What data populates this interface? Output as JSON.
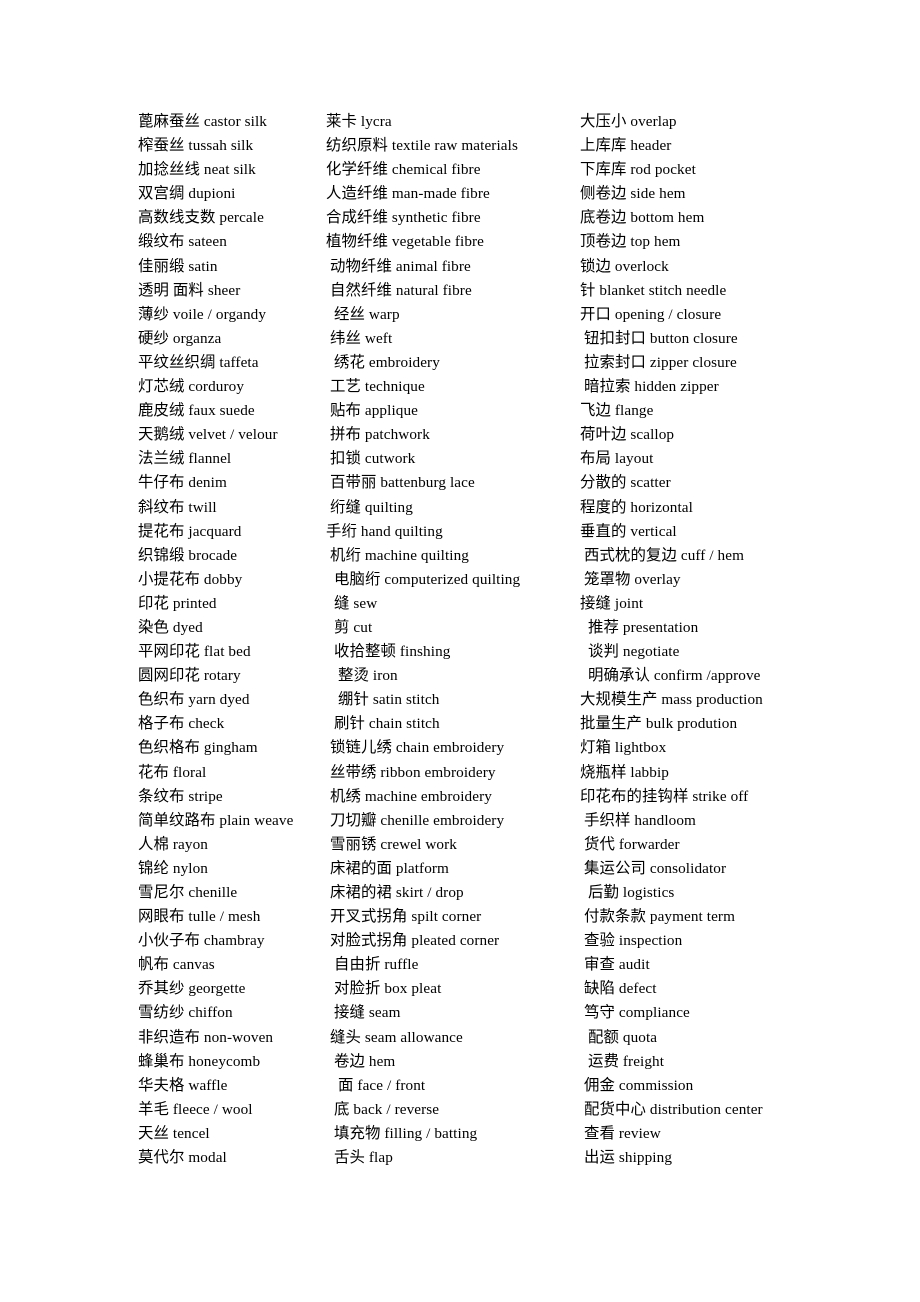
{
  "document": {
    "type": "glossary",
    "title": "Chinese-English Textile / Home Textile Glossary",
    "column_count": 3,
    "rows_per_column": 44
  },
  "columns": [
    {
      "name": "fabrics-and-materials",
      "entries": [
        {
          "zh": "蓖麻蚕丝",
          "en": "castor silk",
          "indent": 0
        },
        {
          "zh": "榨蚕丝",
          "en": "tussah silk",
          "indent": 0
        },
        {
          "zh": "加捻丝线",
          "en": " neat silk",
          "indent": 0
        },
        {
          "zh": "双宫绸",
          "en": "dupioni",
          "indent": 0
        },
        {
          "zh": "高数线支数",
          "en": " percale",
          "indent": 0
        },
        {
          "zh": "缎纹布",
          "en": " sateen",
          "indent": 0
        },
        {
          "zh": "佳丽缎",
          "en": "satin",
          "indent": 0
        },
        {
          "zh": "透明 面料",
          "en": " sheer",
          "indent": 0
        },
        {
          "zh": "薄纱",
          "en": "voile / organdy",
          "indent": 0
        },
        {
          "zh": "硬纱",
          "en": " organza",
          "indent": 0
        },
        {
          "zh": "平纹丝织绸",
          "en": "taffeta",
          "indent": 0
        },
        {
          "zh": "灯芯绒",
          "en": " corduroy",
          "indent": 0
        },
        {
          "zh": "鹿皮绒",
          "en": " faux suede",
          "indent": 0
        },
        {
          "zh": "天鹅绒",
          "en": " velvet / velour",
          "indent": 0
        },
        {
          "zh": "法兰绒",
          "en": " flannel",
          "indent": 0
        },
        {
          "zh": "牛仔布",
          "en": "denim",
          "indent": 0
        },
        {
          "zh": "斜纹布",
          "en": " twill",
          "indent": 0
        },
        {
          "zh": "提花布",
          "en": "jacquard",
          "indent": 0
        },
        {
          "zh": "织锦缎",
          "en": "brocade",
          "indent": 0
        },
        {
          "zh": "小提花布",
          "en": "  dobby",
          "indent": 0
        },
        {
          "zh": "印花",
          "en": "printed",
          "indent": 0
        },
        {
          "zh": "染色",
          "en": "  dyed",
          "indent": 0
        },
        {
          "zh": "平网印花",
          "en": " flat bed",
          "indent": 0
        },
        {
          "zh": "圆网印花",
          "en": "rotary",
          "indent": 0
        },
        {
          "zh": "色织布",
          "en": "yarn dyed",
          "indent": 0
        },
        {
          "zh": "格子布",
          "en": "check",
          "indent": 0
        },
        {
          "zh": "色织格布",
          "en": " gingham",
          "indent": 0
        },
        {
          "zh": "花布",
          "en": "floral",
          "indent": 0
        },
        {
          "zh": "条纹布",
          "en": "stripe",
          "indent": 0
        },
        {
          "zh": "简单纹路布",
          "en": "plain weave",
          "indent": 0
        },
        {
          "zh": "人棉",
          "en": "rayon",
          "indent": 0
        },
        {
          "zh": "锦纶",
          "en": "nylon",
          "indent": 0
        },
        {
          "zh": "雪尼尔",
          "en": " chenille",
          "indent": 0
        },
        {
          "zh": "网眼布",
          "en": " tulle / mesh",
          "indent": 0
        },
        {
          "zh": "小伙子布",
          "en": "chambray",
          "indent": 0
        },
        {
          "zh": "帆布",
          "en": " canvas",
          "indent": 0
        },
        {
          "zh": "乔其纱",
          "en": "georgette",
          "indent": 0
        },
        {
          "zh": "雪纺纱",
          "en": " chiffon",
          "indent": 0
        },
        {
          "zh": "非织造布",
          "en": "non-woven",
          "indent": 0
        },
        {
          "zh": "蜂巢布",
          "en": "honeycomb",
          "indent": 0
        },
        {
          "zh": "华夫格",
          "en": " waffle",
          "indent": 0
        },
        {
          "zh": "羊毛",
          "en": "fleece / wool",
          "indent": 0
        },
        {
          "zh": "天丝",
          "en": " tencel",
          "indent": 0
        },
        {
          "zh": "莫代尔",
          "en": "modal",
          "indent": 0
        }
      ]
    },
    {
      "name": "fibres-and-techniques",
      "entries": [
        {
          "zh": "莱卡",
          "en": " lycra",
          "indent": 0
        },
        {
          "zh": "纺织原料",
          "en": "textile raw materials",
          "indent": 0
        },
        {
          "zh": "化学纤维",
          "en": "chemical fibre",
          "indent": 0
        },
        {
          "zh": "人造纤维",
          "en": "man-made fibre",
          "indent": 0
        },
        {
          "zh": "合成纤维",
          "en": "synthetic fibre",
          "indent": 0
        },
        {
          "zh": "植物纤维",
          "en": " vegetable fibre",
          "indent": 0
        },
        {
          "zh": "动物纤维",
          "en": " animal fibre",
          "indent": 1
        },
        {
          "zh": "自然纤维",
          "en": " natural fibre",
          "indent": 1
        },
        {
          "zh": "经丝",
          "en": "warp",
          "indent": 2
        },
        {
          "zh": "纬丝",
          "en": "weft",
          "indent": 1
        },
        {
          "zh": "绣花",
          "en": "embroidery",
          "indent": 2
        },
        {
          "zh": "工艺",
          "en": "technique",
          "indent": 1
        },
        {
          "zh": "贴布",
          "en": "applique",
          "indent": 1
        },
        {
          "zh": "拼布",
          "en": "patchwork",
          "indent": 1
        },
        {
          "zh": "扣锁",
          "en": "cutwork",
          "indent": 1
        },
        {
          "zh": "百带丽",
          "en": "battenburg lace",
          "indent": 1
        },
        {
          "zh": "绗缝",
          "en": "quilting",
          "indent": 1
        },
        {
          "zh": "手绗",
          "en": "hand quilting",
          "indent": 0
        },
        {
          "zh": "机绗",
          "en": "machine quilting",
          "indent": 1
        },
        {
          "zh": "电脑绗",
          "en": "computerized quilting",
          "indent": 2
        },
        {
          "zh": "缝",
          "en": "sew",
          "indent": 2
        },
        {
          "zh": "剪",
          "en": " cut",
          "indent": 2
        },
        {
          "zh": "收拾整顿",
          "en": "finshing",
          "indent": 2
        },
        {
          "zh": "整烫",
          "en": " iron",
          "indent": 3
        },
        {
          "zh": "绷针",
          "en": "satin stitch",
          "indent": 3
        },
        {
          "zh": "刷针",
          "en": " chain stitch",
          "indent": 2
        },
        {
          "zh": "锁链儿绣",
          "en": "chain embroidery",
          "indent": 1
        },
        {
          "zh": "丝带绣",
          "en": "ribbon embroidery",
          "indent": 1
        },
        {
          "zh": "机绣",
          "en": " machine embroidery",
          "indent": 1
        },
        {
          "zh": "刀切瓣",
          "en": "chenille embroidery",
          "indent": 1
        },
        {
          "zh": "雪丽锈",
          "en": "crewel work",
          "indent": 1
        },
        {
          "zh": "床裙的面",
          "en": "platform",
          "indent": 1
        },
        {
          "zh": "床裙的裙",
          "en": "  skirt / drop",
          "indent": 1
        },
        {
          "zh": "开叉式拐角",
          "en": "spilt corner",
          "indent": 1
        },
        {
          "zh": "对脸式拐角",
          "en": " pleated corner",
          "indent": 1
        },
        {
          "zh": "自由折",
          "en": " ruffle",
          "indent": 2
        },
        {
          "zh": "对脸折",
          "en": "box pleat",
          "indent": 2
        },
        {
          "zh": "接缝",
          "en": " seam",
          "indent": 2
        },
        {
          "zh": "缝头",
          "en": " seam allowance",
          "indent": 1
        },
        {
          "zh": "卷边",
          "en": " hem",
          "indent": 2
        },
        {
          "zh": "面",
          "en": " face / front",
          "indent": 3
        },
        {
          "zh": "底",
          "en": "  back / reverse",
          "indent": 2
        },
        {
          "zh": "填充物",
          "en": "  filling / batting",
          "indent": 2
        },
        {
          "zh": "舌头",
          "en": " flap",
          "indent": 2
        }
      ]
    },
    {
      "name": "construction-and-trade",
      "entries": [
        {
          "zh": "大压小",
          "en": "overlap",
          "indent": 0
        },
        {
          "zh": "上库库",
          "en": "header",
          "indent": 0
        },
        {
          "zh": "下库库",
          "en": "rod pocket",
          "indent": 0
        },
        {
          "zh": "侧卷边",
          "en": "side hem",
          "indent": 0
        },
        {
          "zh": "底卷边",
          "en": "bottom hem",
          "indent": 0
        },
        {
          "zh": "顶卷边",
          "en": "top hem",
          "indent": 0
        },
        {
          "zh": "锁边",
          "en": "overlock",
          "indent": 0
        },
        {
          "zh": "针",
          "en": "blanket stitch needle",
          "indent": 0
        },
        {
          "zh": "开口",
          "en": " opening / closure",
          "indent": 0
        },
        {
          "zh": "钮扣封口",
          "en": "button closure",
          "indent": 1
        },
        {
          "zh": "拉索封口",
          "en": "zipper closure",
          "indent": 1
        },
        {
          "zh": "暗拉索",
          "en": "hidden zipper",
          "indent": 1
        },
        {
          "zh": "飞边",
          "en": "flange",
          "indent": 0
        },
        {
          "zh": "荷叶边",
          "en": "scallop",
          "indent": 0
        },
        {
          "zh": "布局",
          "en": "layout",
          "indent": 0
        },
        {
          "zh": "分散的",
          "en": "scatter",
          "indent": 0
        },
        {
          "zh": "程度的",
          "en": "horizontal",
          "indent": 0
        },
        {
          "zh": "垂直的",
          "en": " vertical",
          "indent": 0
        },
        {
          "zh": "西式枕的复边",
          "en": "cuff / hem",
          "indent": 1
        },
        {
          "zh": "笼罩物",
          "en": "overlay",
          "indent": 1
        },
        {
          "zh": "接缝",
          "en": "joint",
          "indent": 0
        },
        {
          "zh": "推荐",
          "en": "presentation",
          "indent": 2
        },
        {
          "zh": "谈判",
          "en": "negotiate",
          "indent": 2
        },
        {
          "zh": "明确承认",
          "en": "confirm /approve",
          "indent": 2
        },
        {
          "zh": "大规模生产",
          "en": "mass production",
          "indent": 0
        },
        {
          "zh": "批量生产",
          "en": "bulk prodution",
          "indent": 0
        },
        {
          "zh": "灯箱",
          "en": "lightbox",
          "indent": 0
        },
        {
          "zh": "烧瓶样",
          "en": "labbip",
          "indent": 0
        },
        {
          "zh": "印花布的挂钩样",
          "en": "strike off",
          "indent": 0
        },
        {
          "zh": "手织样",
          "en": "handloom",
          "indent": 1
        },
        {
          "zh": "货代",
          "en": "forwarder",
          "indent": 1
        },
        {
          "zh": "集运公司",
          "en": "consolidator",
          "indent": 1
        },
        {
          "zh": "后勤",
          "en": "logistics",
          "indent": 2
        },
        {
          "zh": "付款条款",
          "en": "payment term",
          "indent": 1
        },
        {
          "zh": "查验",
          "en": "inspection",
          "indent": 1
        },
        {
          "zh": "审查",
          "en": "audit",
          "indent": 1
        },
        {
          "zh": "缺陷",
          "en": "defect",
          "indent": 1
        },
        {
          "zh": "笃守",
          "en": "compliance",
          "indent": 1
        },
        {
          "zh": "配额",
          "en": "quota",
          "indent": 2
        },
        {
          "zh": "运费",
          "en": "freight",
          "indent": 2
        },
        {
          "zh": "佣金",
          "en": "commission",
          "indent": 1
        },
        {
          "zh": "配货中心",
          "en": "distribution center",
          "indent": 1
        },
        {
          "zh": "查看",
          "en": "review",
          "indent": 1
        },
        {
          "zh": "出运",
          "en": "shipping",
          "indent": 1
        }
      ]
    }
  ]
}
